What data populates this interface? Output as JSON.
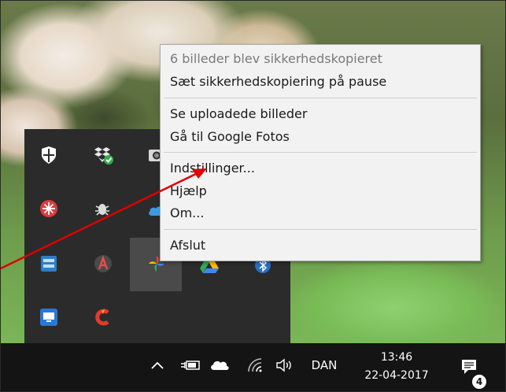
{
  "context_menu": {
    "status": "6 billeder blev sikkerhedskopieret",
    "pause": "Sæt sikkerhedskopiering på pause",
    "view_uploaded": "Se uploadede billeder",
    "goto_photos": "Gå til Google Fotos",
    "settings": "Indstillinger...",
    "help": "Hjælp",
    "about": "Om...",
    "quit": "Afslut"
  },
  "tray_icons": [
    "shield-icon",
    "dropbox-icon",
    "camera-icon",
    "red-snowflake-icon",
    "bug-icon",
    "cloud-icon",
    "network-drive-icon",
    "acrobat-icon",
    "google-photos-icon",
    "google-drive-icon",
    "bluetooth-icon",
    "monitor-icon",
    "ccleaner-icon"
  ],
  "taskbar": {
    "language": "DAN",
    "time": "13:46",
    "date": "22-04-2017",
    "notification_count": "4"
  },
  "annotation": {
    "color": "#e00000"
  }
}
